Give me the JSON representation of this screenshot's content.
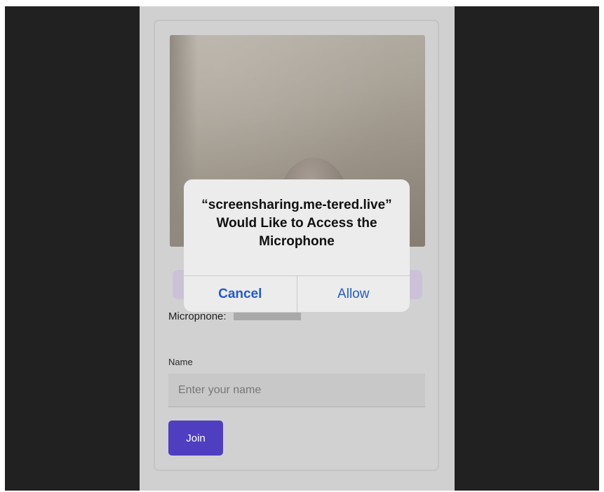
{
  "permission_dialog": {
    "title": "“screensharing.me-tered.live” Would Like to Access the Microphone",
    "cancel_label": "Cancel",
    "allow_label": "Allow"
  },
  "join_form": {
    "microphone_label": "Micropnone:",
    "name_label": "Name",
    "name_placeholder": "Enter your name",
    "name_value": "",
    "join_label": "Join"
  },
  "colors": {
    "join_button": "#4f3fc0",
    "dialog_button_text": "#1f5bd1",
    "page_background": "#d0d0d0",
    "outer_background": "#212121"
  }
}
